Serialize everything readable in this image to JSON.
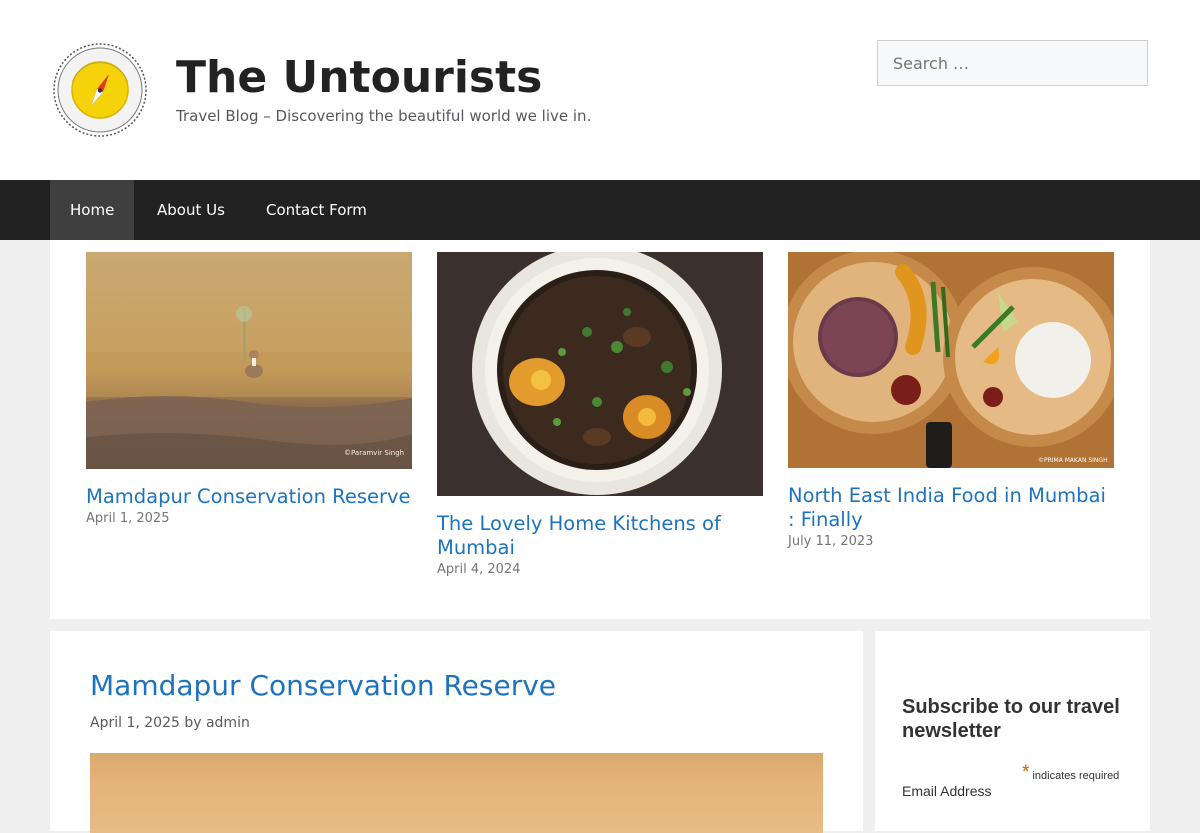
{
  "site": {
    "title": "The Untourists",
    "tagline": "Travel Blog – Discovering the beautiful world we live in.",
    "logo": {
      "icon": "compass-badge-icon",
      "ring_text_top": "HANDPICKED BY",
      "ring_text_bottom": "THEUNTOURISTS.COM"
    }
  },
  "search": {
    "placeholder": "Search …",
    "value": ""
  },
  "nav": {
    "items": [
      {
        "label": "Home",
        "active": true
      },
      {
        "label": "About Us",
        "active": false
      },
      {
        "label": "Contact Form",
        "active": false
      }
    ]
  },
  "featured": [
    {
      "title": "Mamdapur Conservation Reserve",
      "date": "April 1, 2025",
      "image": "grassland-bird-photo",
      "credit": "©Paramvir Singh"
    },
    {
      "title": "The Lovely Home Kitchens of Mumbai",
      "date": "April 4, 2024",
      "image": "egg-curry-pot-photo"
    },
    {
      "title": "North East India Food in Mumbai : Finally",
      "date": "July 11, 2023",
      "image": "north-east-thali-photo",
      "credit": "©PRIMA MAKAN SINGH"
    }
  ],
  "post": {
    "title": "Mamdapur Conservation Reserve",
    "date": "April 1, 2025",
    "by": "by",
    "author": "admin"
  },
  "sidebar": {
    "widget_title": "Subscribe to our travel newsletter",
    "required_star": "*",
    "required_note": "indicates required",
    "email_label": "Email Address"
  },
  "colors": {
    "link": "#1e73be",
    "nav_bg": "#222222",
    "nav_active_bg": "#3f3f3f",
    "page_bg": "#efefef",
    "required_star": "#cc6600"
  }
}
